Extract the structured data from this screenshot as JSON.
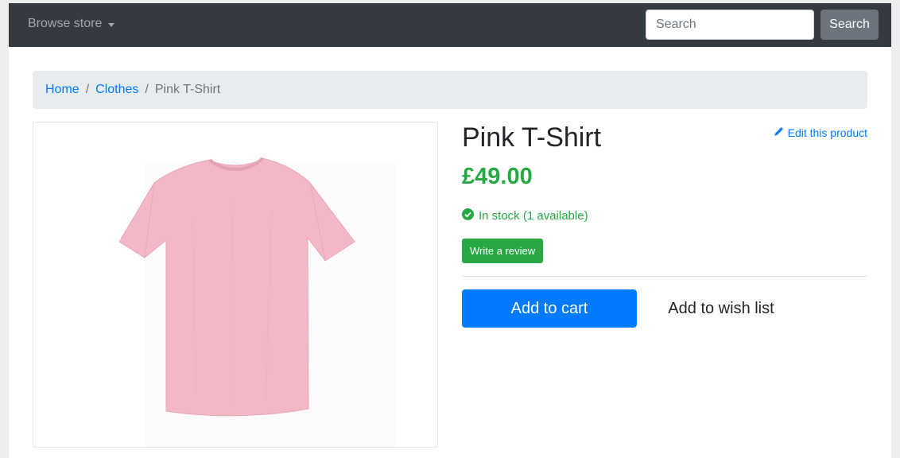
{
  "navbar": {
    "browse_label": "Browse store",
    "search_placeholder": "Search",
    "search_button": "Search"
  },
  "breadcrumb": {
    "items": [
      "Home",
      "Clothes"
    ],
    "active": "Pink T-Shirt"
  },
  "product": {
    "title": "Pink T-Shirt",
    "edit_label": "Edit this product",
    "price": "£49.00",
    "stock": "In stock (1 available)",
    "review_button": "Write a review",
    "add_to_cart": "Add to cart",
    "add_to_wishlist": "Add to wish list",
    "image": "pink-tshirt-photo"
  },
  "colors": {
    "navbar_bg": "#343a40",
    "primary": "#007bff",
    "success": "#28a745",
    "tshirt": "#f3b8c6"
  }
}
